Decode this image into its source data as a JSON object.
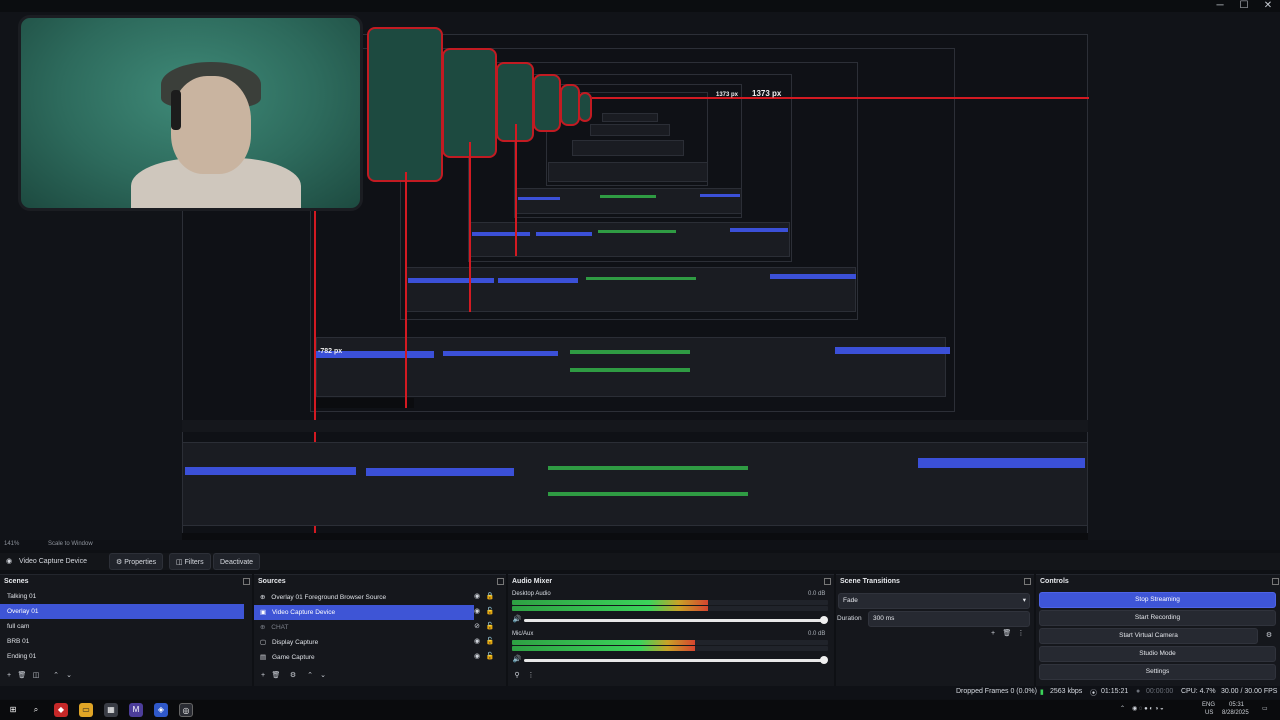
{
  "window": {
    "title_icon": "obs-mark",
    "minimize": "─",
    "maximize": "☐",
    "close": "✕"
  },
  "preview": {
    "measure_label_1": "1373 px",
    "measure_label_2": "1373 px",
    "measure_label_3": "-782 px"
  },
  "mini_status": {
    "zoom": "141%",
    "scale": "Scale to Window"
  },
  "toolbar": {
    "source_name": "Video Capture Device",
    "properties": "Properties",
    "filters": "Filters",
    "deactivate": "Deactivate"
  },
  "scenes": {
    "title": "Scenes",
    "items": [
      "Talking 01",
      "Overlay 01",
      "full cam",
      "BRB 01",
      "Ending 01"
    ],
    "selected_index": 1
  },
  "sources": {
    "title": "Sources",
    "items": [
      {
        "label": "Overlay 01  Foreground Browser Source",
        "icon": "browser-icon"
      },
      {
        "label": "Video Capture Device",
        "icon": "camera-icon"
      },
      {
        "label": "CHAT",
        "icon": "browser-icon"
      },
      {
        "label": "Display Capture",
        "icon": "display-icon"
      },
      {
        "label": "Game Capture",
        "icon": "game-icon"
      }
    ],
    "selected_index": 1
  },
  "audio_mixer": {
    "title": "Audio Mixer",
    "channels": [
      {
        "name": "Desktop Audio",
        "db": "0.0 dB",
        "level": 0.62
      },
      {
        "name": "Mic/Aux",
        "db": "0.0 dB",
        "level": 0.58
      }
    ],
    "scale": [
      "-60",
      "-55",
      "-50",
      "-45",
      "-40",
      "-35",
      "-30",
      "-25",
      "-20",
      "-15",
      "-10",
      "-5",
      "0"
    ]
  },
  "transitions": {
    "title": "Scene Transitions",
    "type": "Fade",
    "duration_label": "Duration",
    "duration_value": "300 ms"
  },
  "controls": {
    "title": "Controls",
    "stop_streaming": "Stop Streaming",
    "start_recording": "Start Recording",
    "start_virtual_camera": "Start Virtual Camera",
    "studio_mode": "Studio Mode",
    "settings": "Settings"
  },
  "statusbar": {
    "dropped_frames": "Dropped Frames 0 (0.0%)",
    "bitrate": "2563 kbps",
    "stream_time": "01:15:21",
    "rec_time": "00:00:00",
    "cpu": "CPU: 4.7%",
    "fps": "30.00 / 30.00 FPS"
  },
  "taskbar": {
    "lang": "ENG",
    "region": "US",
    "time": "05:31",
    "date": "8/28/2025"
  },
  "colors": {
    "accent": "#3e55d6",
    "meter_green": "#2ea043",
    "measure_red": "#d31a22"
  }
}
